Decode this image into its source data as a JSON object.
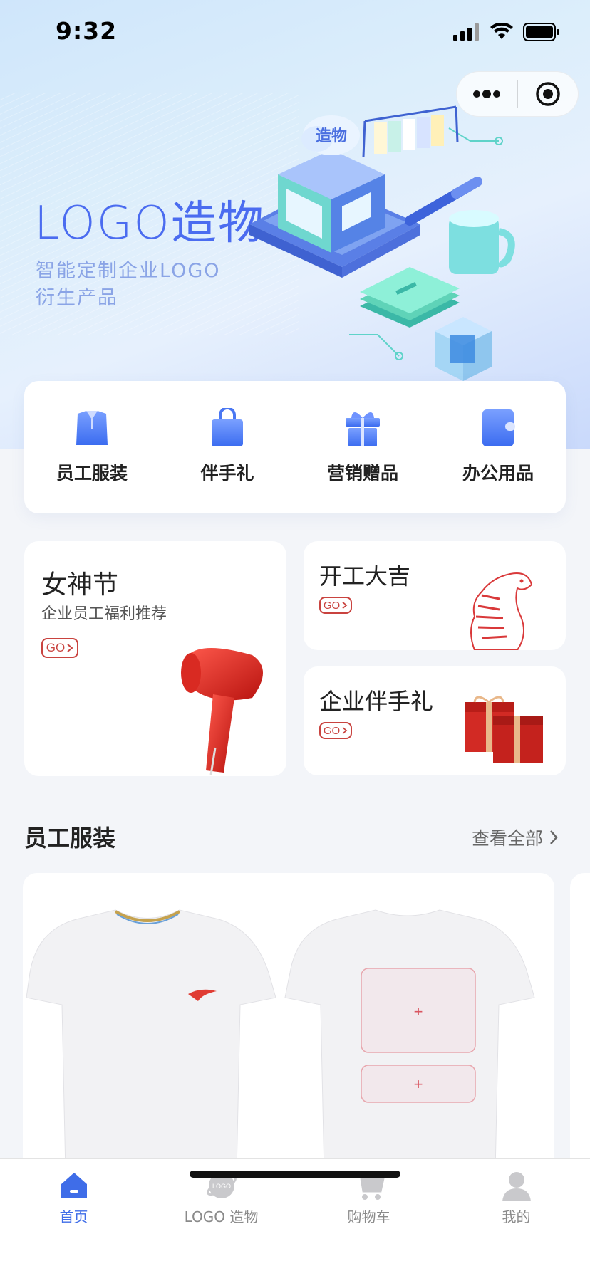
{
  "status_bar": {
    "time": "9:32"
  },
  "hero": {
    "title": "LOGO造物",
    "subtitle": "智能定制企业LOGO衍生产品",
    "cloud_badge": "造物"
  },
  "categories": [
    {
      "label": "员工服装",
      "icon": "shirt-icon"
    },
    {
      "label": "伴手礼",
      "icon": "bag-icon"
    },
    {
      "label": "营销赠品",
      "icon": "gift-icon"
    },
    {
      "label": "办公用品",
      "icon": "folder-icon"
    }
  ],
  "promos": {
    "big": {
      "title": "女神节",
      "subtitle": "企业员工福利推荐",
      "go": "GO"
    },
    "small1": {
      "title": "开工大吉",
      "go": "GO"
    },
    "small2": {
      "title": "企业伴手礼",
      "go": "GO"
    }
  },
  "section": {
    "title": "员工服装",
    "more": "查看全部"
  },
  "product": {
    "plus_1": "+",
    "plus_2": "+"
  },
  "tabbar": {
    "items": [
      {
        "label": "首页",
        "icon": "home-icon",
        "active": true
      },
      {
        "label": "LOGO 造物",
        "icon": "logo-icon",
        "active": false
      },
      {
        "label": "购物车",
        "icon": "cart-icon",
        "active": false
      },
      {
        "label": "我的",
        "icon": "user-icon",
        "active": false
      }
    ]
  },
  "colors": {
    "accent": "#3f6de8",
    "brand_red": "#c9433f"
  }
}
